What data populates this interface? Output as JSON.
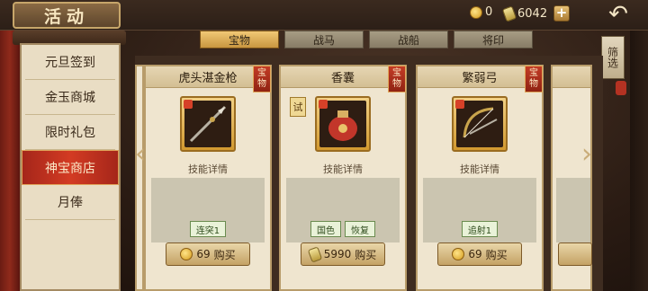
{
  "header": {
    "title": "活动",
    "coins": "0",
    "gold": "6042",
    "plus": "+",
    "back": "↶"
  },
  "menu": {
    "items": [
      {
        "label": "元旦签到",
        "active": false
      },
      {
        "label": "金玉商城",
        "active": false
      },
      {
        "label": "限时礼包",
        "active": false
      },
      {
        "label": "神宝商店",
        "active": true
      },
      {
        "label": "月俸",
        "active": false
      }
    ]
  },
  "tabs": [
    {
      "label": "宝物",
      "active": true
    },
    {
      "label": "战马",
      "active": false
    },
    {
      "label": "战船",
      "active": false
    },
    {
      "label": "将印",
      "active": false
    }
  ],
  "filter_label": "筛选",
  "nav": {
    "left_arrow": "‹",
    "right_arrow": "›"
  },
  "cards": [
    {
      "name": "虎头湛金枪",
      "tag": "宝物",
      "trial": "",
      "detail": "技能详情",
      "skills": [
        "连突1"
      ],
      "currency": "coin",
      "price": "69",
      "buy": "购买"
    },
    {
      "name": "香囊",
      "tag": "宝物",
      "trial": "试",
      "detail": "技能详情",
      "skills": [
        "国色",
        "恢复"
      ],
      "currency": "ingot",
      "price": "5990",
      "buy": "购买"
    },
    {
      "name": "繁弱弓",
      "tag": "宝物",
      "trial": "",
      "detail": "技能详情",
      "skills": [
        "追射1"
      ],
      "currency": "coin",
      "price": "69",
      "buy": "购买"
    }
  ]
}
